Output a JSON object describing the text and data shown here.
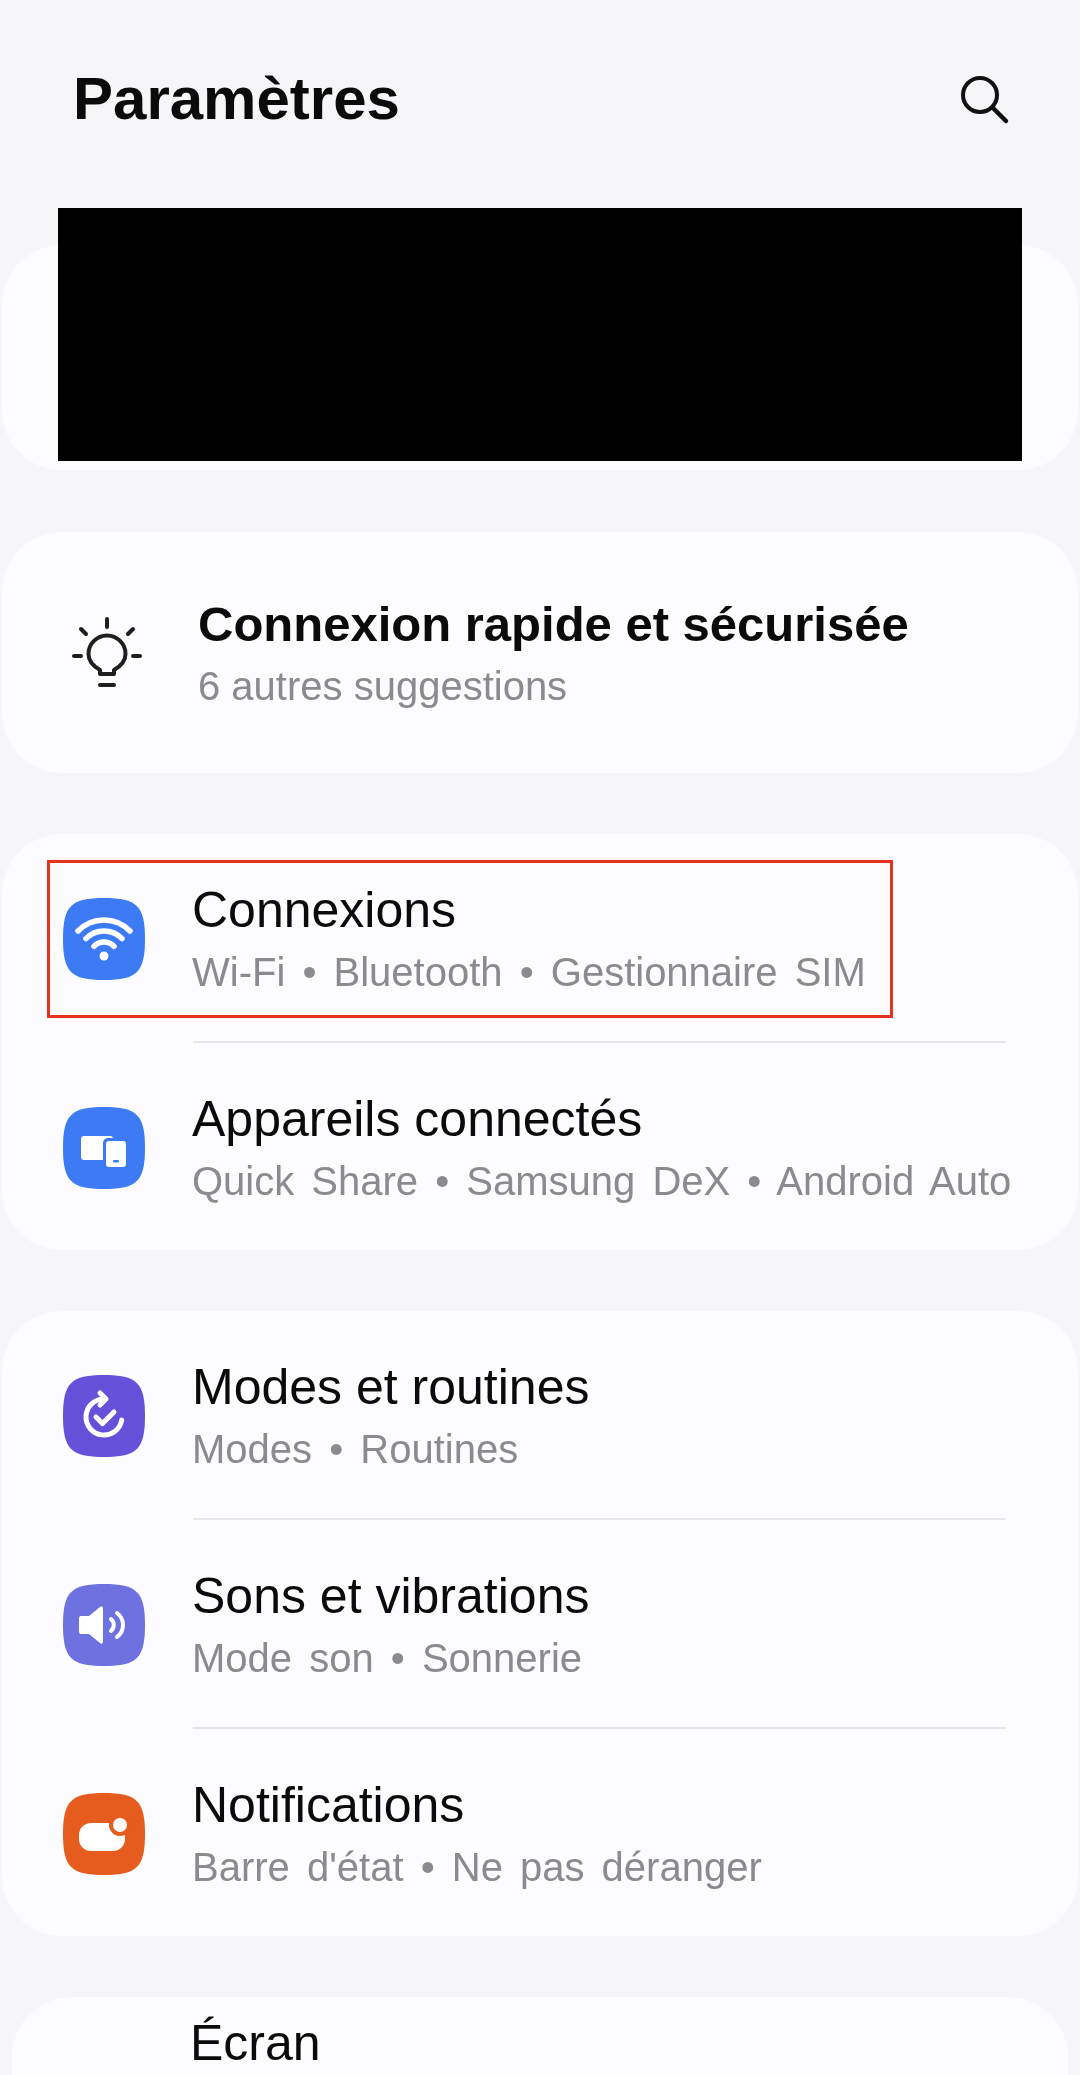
{
  "header": {
    "title": "Paramètres"
  },
  "suggestion": {
    "title": "Connexion rapide et sécurisée",
    "subtitle": "6 autres suggestions"
  },
  "groups": [
    {
      "items": [
        {
          "kind": "wifi",
          "color": "#3d7bf5",
          "title": "Connexions",
          "subtitle": "Wi-Fi • Bluetooth • Gestionnaire SIM",
          "highlighted": true
        },
        {
          "kind": "devices",
          "color": "#3d7bf5",
          "title": "Appareils connectés",
          "subtitle": "Quick Share • Samsung DeX • Android Auto",
          "highlighted": false
        }
      ]
    },
    {
      "items": [
        {
          "kind": "modes",
          "color": "#6551d9",
          "title": "Modes et routines",
          "subtitle": "Modes • Routines",
          "highlighted": false
        },
        {
          "kind": "sound",
          "color": "#6e71e0",
          "title": "Sons et vibrations",
          "subtitle": "Mode son • Sonnerie",
          "highlighted": false
        },
        {
          "kind": "notifications",
          "color": "#e65c1e",
          "title": "Notifications",
          "subtitle": "Barre d'état • Ne pas déranger",
          "highlighted": false
        }
      ]
    },
    {
      "items": [
        {
          "title": "Écran",
          "highlighted": false
        }
      ]
    }
  ]
}
